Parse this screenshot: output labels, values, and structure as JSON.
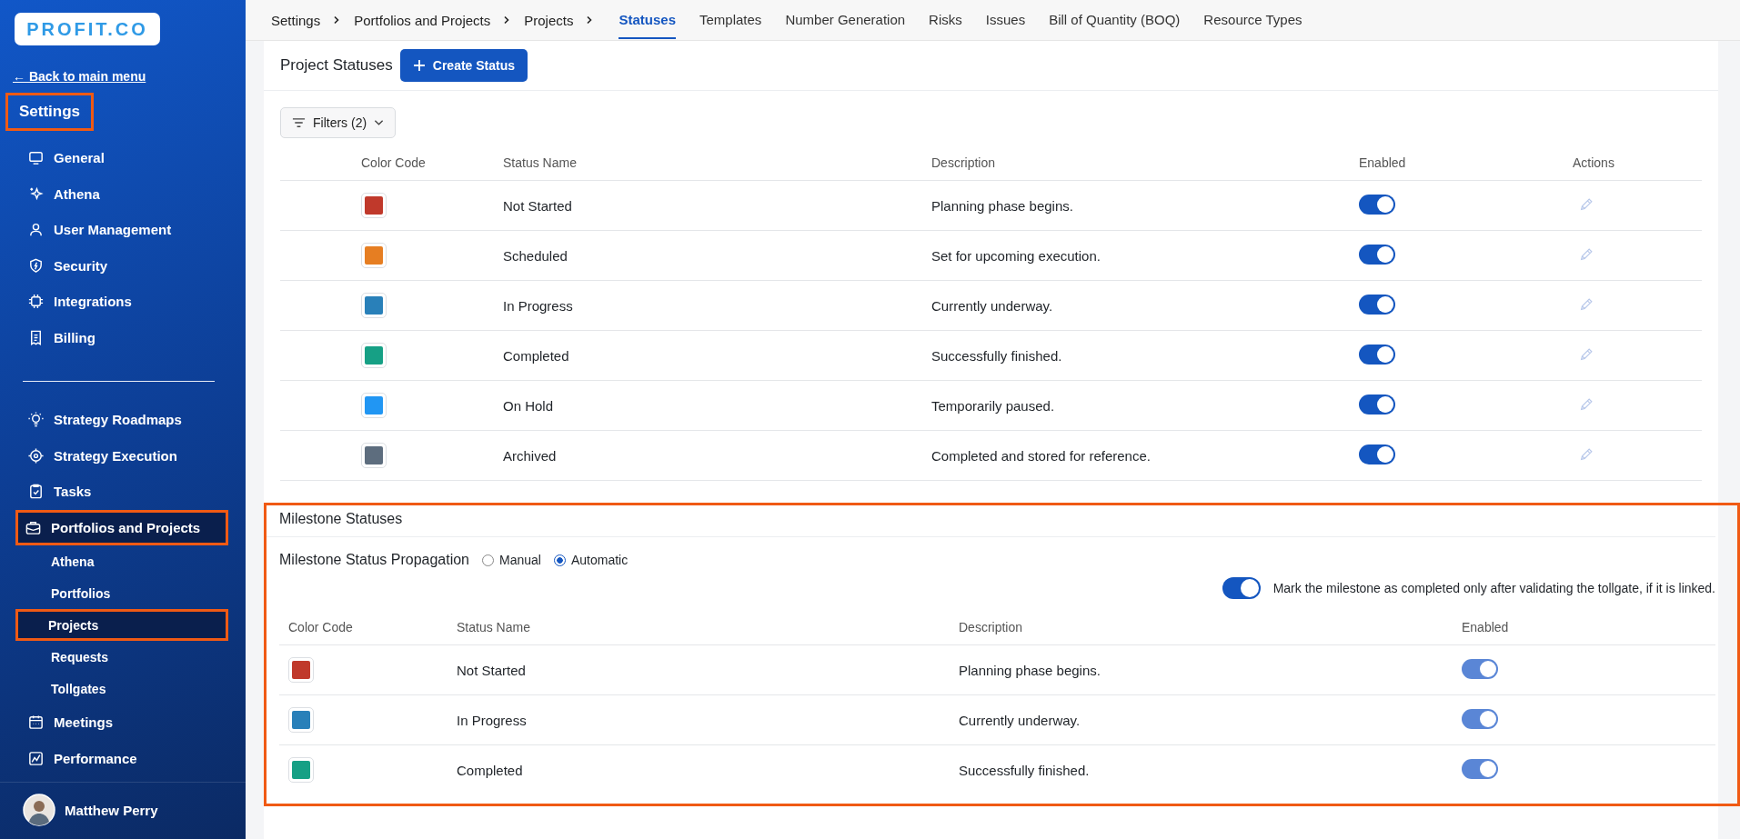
{
  "sidebar": {
    "logo": "PROFIT.CO",
    "back_link": "← Back to main menu",
    "heading": {
      "label": "Settings",
      "highlighted": true
    },
    "items": [
      {
        "label": "General",
        "kind": "monitor",
        "selected": false,
        "highlighted": false
      },
      {
        "label": "Athena",
        "kind": "sparkle",
        "selected": false,
        "highlighted": false
      },
      {
        "label": "User Management",
        "kind": "user",
        "selected": false,
        "highlighted": false
      },
      {
        "label": "Security",
        "kind": "shield",
        "selected": false,
        "highlighted": false
      },
      {
        "label": "Integrations",
        "kind": "chip",
        "selected": false,
        "highlighted": false
      },
      {
        "label": "Billing",
        "kind": "receipt",
        "selected": false,
        "highlighted": false
      }
    ],
    "items2": [
      {
        "label": "Strategy Roadmaps",
        "kind": "bulb",
        "selected": false,
        "highlighted": false
      },
      {
        "label": "Strategy Execution",
        "kind": "target",
        "selected": false,
        "highlighted": false
      },
      {
        "label": "Tasks",
        "kind": "clipboard",
        "selected": false,
        "highlighted": false
      },
      {
        "label": "Portfolios and Projects",
        "kind": "briefcase",
        "selected": true,
        "highlighted": true,
        "children": [
          {
            "label": "Athena",
            "selected": false,
            "highlighted": false
          },
          {
            "label": "Portfolios",
            "selected": false,
            "highlighted": false
          },
          {
            "label": "Projects",
            "selected": true,
            "highlighted": true
          },
          {
            "label": "Requests",
            "selected": false,
            "highlighted": false
          },
          {
            "label": "Tollgates",
            "selected": false,
            "highlighted": false
          }
        ]
      },
      {
        "label": "Meetings",
        "kind": "calendar",
        "selected": false,
        "highlighted": false
      },
      {
        "label": "Performance",
        "kind": "chart",
        "selected": false,
        "highlighted": false
      }
    ],
    "user": "Matthew Perry"
  },
  "breadcrumb": [
    "Settings",
    "Portfolios and Projects",
    "Projects"
  ],
  "tabs": [
    {
      "label": "Statuses",
      "selected": true
    },
    {
      "label": "Templates",
      "selected": false
    },
    {
      "label": "Number Generation",
      "selected": false
    },
    {
      "label": "Risks",
      "selected": false
    },
    {
      "label": "Issues",
      "selected": false
    },
    {
      "label": "Bill of Quantity (BOQ)",
      "selected": false
    },
    {
      "label": "Resource Types",
      "selected": false
    }
  ],
  "project_statuses": {
    "title": "Project Statuses",
    "create_button": "Create Status",
    "filters_button": "Filters (2)",
    "columns": [
      "Color Code",
      "Status Name",
      "Description",
      "Enabled",
      "Actions"
    ],
    "rows": [
      {
        "color": "#c0392b",
        "name": "Not Started",
        "description": "Planning phase begins.",
        "enabled": true
      },
      {
        "color": "#e67e22",
        "name": "Scheduled",
        "description": "Set for upcoming execution.",
        "enabled": true
      },
      {
        "color": "#2980b9",
        "name": "In Progress",
        "description": "Currently underway.",
        "enabled": true
      },
      {
        "color": "#16a085",
        "name": "Completed",
        "description": "Successfully finished.",
        "enabled": true
      },
      {
        "color": "#2196f3",
        "name": "On Hold",
        "description": "Temporarily paused.",
        "enabled": true
      },
      {
        "color": "#5d6d7e",
        "name": "Archived",
        "description": "Completed and stored for reference.",
        "enabled": true
      }
    ]
  },
  "milestone_statuses": {
    "title": "Milestone Statuses",
    "highlighted": true,
    "propagation_label": "Milestone Status Propagation",
    "options": [
      {
        "label": "Manual",
        "selected": false
      },
      {
        "label": "Automatic",
        "selected": true
      }
    ],
    "tollgate_toggle": {
      "label": "Mark the milestone as completed only after validating the tollgate, if it is linked.",
      "on": true
    },
    "columns": [
      "Color Code",
      "Status Name",
      "Description",
      "Enabled"
    ],
    "rows": [
      {
        "color": "#c0392b",
        "name": "Not Started",
        "description": "Planning phase begins.",
        "enabled": true,
        "disabled": true
      },
      {
        "color": "#2980b9",
        "name": "In Progress",
        "description": "Currently underway.",
        "enabled": true,
        "disabled": true
      },
      {
        "color": "#16a085",
        "name": "Completed",
        "description": "Successfully finished.",
        "enabled": true,
        "disabled": true
      }
    ]
  }
}
